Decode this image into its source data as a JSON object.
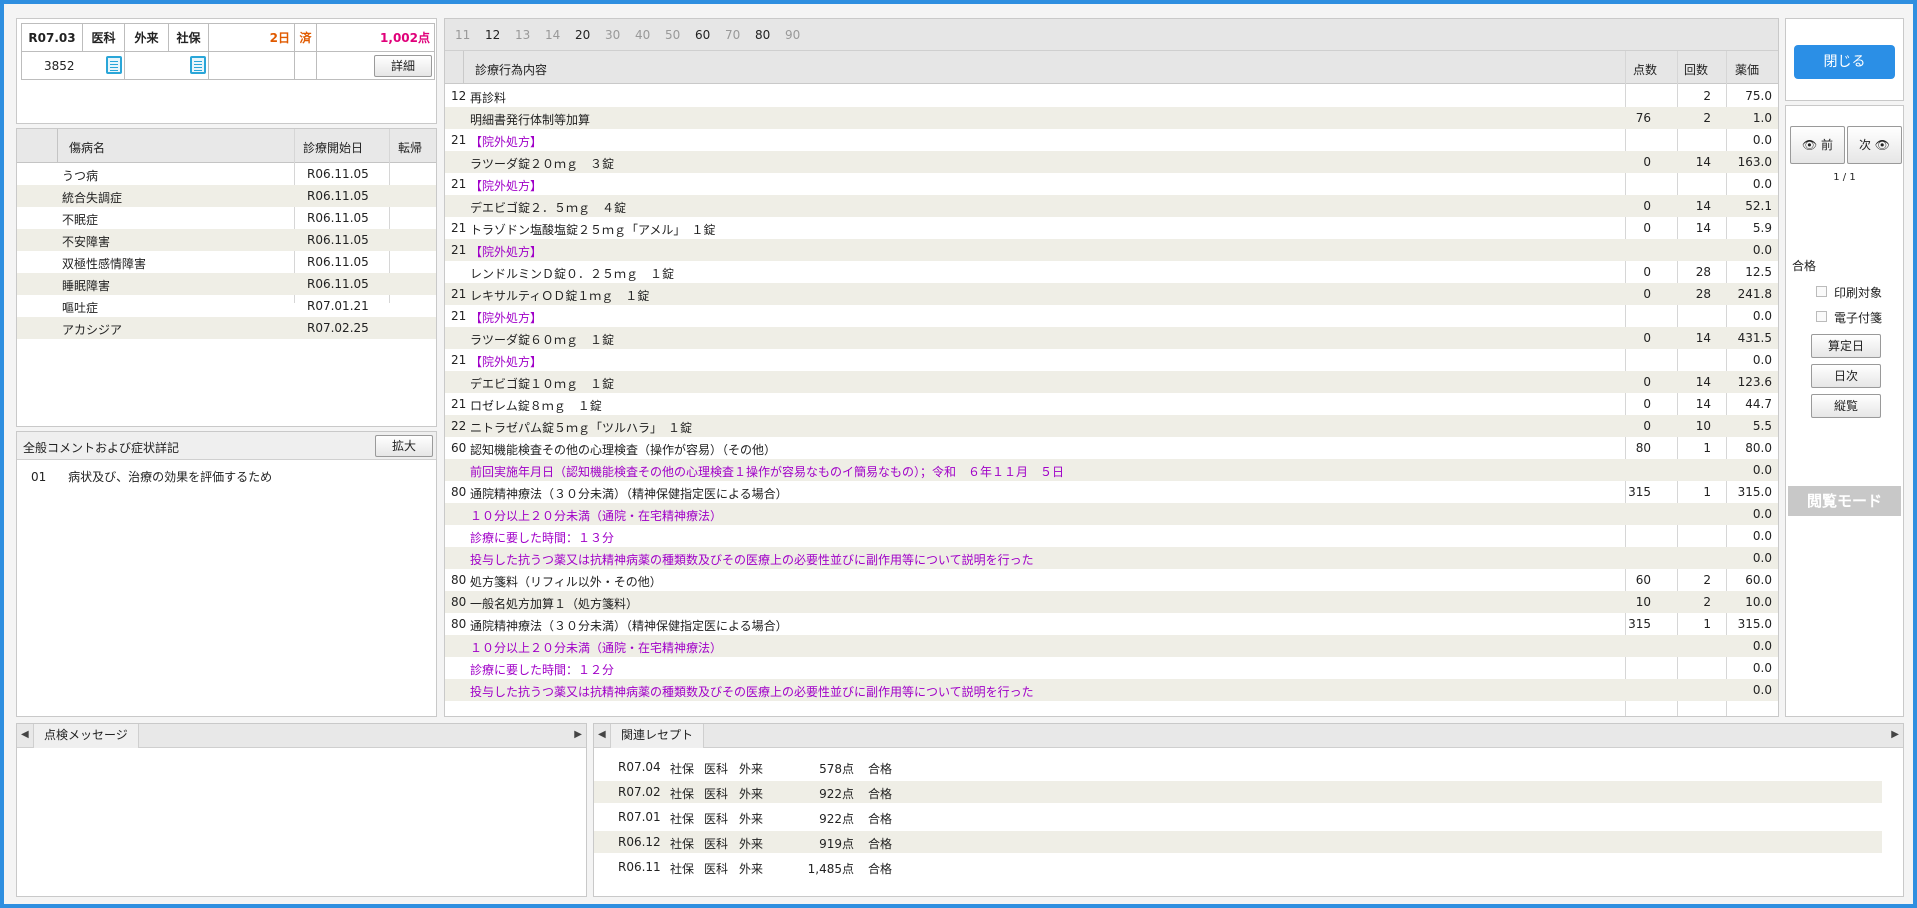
{
  "header": {
    "date": "R07.03",
    "dept": "医科",
    "type": "外来",
    "insurer": "社保",
    "days": "2日",
    "status": "済",
    "points": "1,002点",
    "patient_no": "3852",
    "detail_label": "詳細"
  },
  "diseases": {
    "col_name": "傷病名",
    "col_start": "診療開始日",
    "col_outcome": "転帰",
    "rows": [
      {
        "name": "うつ病",
        "date": "R06.11.05"
      },
      {
        "name": "統合失調症",
        "date": "R06.11.05"
      },
      {
        "name": "不眠症",
        "date": "R06.11.05"
      },
      {
        "name": "不安障害",
        "date": "R06.11.05"
      },
      {
        "name": "双極性感情障害",
        "date": "R06.11.05"
      },
      {
        "name": "睡眠障害",
        "date": "R06.11.05"
      },
      {
        "name": "嘔吐症",
        "date": "R07.01.21"
      },
      {
        "name": "アカシジア",
        "date": "R07.02.25"
      }
    ]
  },
  "comments": {
    "title": "全般コメントおよび症状詳記",
    "expand_label": "拡大",
    "items": [
      {
        "code": "01",
        "text": "病状及び、治療の効果を評価するため"
      }
    ]
  },
  "main": {
    "tabs": [
      "11",
      "12",
      "13",
      "14",
      "20",
      "30",
      "40",
      "50",
      "60",
      "70",
      "80",
      "90"
    ],
    "col_content": "診療行為内容",
    "col_points": "点数",
    "col_count": "回数",
    "col_price": "薬価",
    "rows": [
      {
        "code": "12",
        "text": "再診料",
        "pts": "",
        "cnt": "2",
        "price": "75.0",
        "purple": false
      },
      {
        "code": "",
        "text": "明細書発行体制等加算",
        "pts": "76",
        "cnt": "2",
        "price": "1.0",
        "purple": false
      },
      {
        "code": "21",
        "text": "【院外処方】",
        "pts": "",
        "cnt": "",
        "price": "0.0",
        "purple": true
      },
      {
        "code": "",
        "text": "ラツーダ錠２０ｍｇ　３錠",
        "pts": "0",
        "cnt": "14",
        "price": "163.0",
        "purple": false
      },
      {
        "code": "21",
        "text": "【院外処方】",
        "pts": "",
        "cnt": "",
        "price": "0.0",
        "purple": true
      },
      {
        "code": "",
        "text": "デエビゴ錠２．５ｍｇ　４錠",
        "pts": "0",
        "cnt": "14",
        "price": "52.1",
        "purple": false
      },
      {
        "code": "21",
        "text": "トラゾドン塩酸塩錠２５ｍｇ「アメル」　１錠",
        "pts": "0",
        "cnt": "14",
        "price": "5.9",
        "purple": false
      },
      {
        "code": "21",
        "text": "【院外処方】",
        "pts": "",
        "cnt": "",
        "price": "0.0",
        "purple": true
      },
      {
        "code": "",
        "text": "レンドルミンＤ錠０．２５ｍｇ　１錠",
        "pts": "0",
        "cnt": "28",
        "price": "12.5",
        "purple": false
      },
      {
        "code": "21",
        "text": "レキサルティＯＤ錠１ｍｇ　１錠",
        "pts": "0",
        "cnt": "28",
        "price": "241.8",
        "purple": false
      },
      {
        "code": "21",
        "text": "【院外処方】",
        "pts": "",
        "cnt": "",
        "price": "0.0",
        "purple": true
      },
      {
        "code": "",
        "text": "ラツーダ錠６０ｍｇ　１錠",
        "pts": "0",
        "cnt": "14",
        "price": "431.5",
        "purple": false
      },
      {
        "code": "21",
        "text": "【院外処方】",
        "pts": "",
        "cnt": "",
        "price": "0.0",
        "purple": true
      },
      {
        "code": "",
        "text": "デエビゴ錠１０ｍｇ　１錠",
        "pts": "0",
        "cnt": "14",
        "price": "123.6",
        "purple": false
      },
      {
        "code": "21",
        "text": "ロゼレム錠８ｍｇ　１錠",
        "pts": "0",
        "cnt": "14",
        "price": "44.7",
        "purple": false
      },
      {
        "code": "22",
        "text": "ニトラゼパム錠５ｍｇ「ツルハラ」　１錠",
        "pts": "0",
        "cnt": "10",
        "price": "5.5",
        "purple": false
      },
      {
        "code": "60",
        "text": "認知機能検査その他の心理検査（操作が容易）（その他）",
        "pts": "80",
        "cnt": "1",
        "price": "80.0",
        "purple": false
      },
      {
        "code": "",
        "text": "前回実施年月日（認知機能検査その他の心理検査１操作が容易なものイ簡易なもの）；令和　６年１１月　５日",
        "pts": "",
        "cnt": "",
        "price": "0.0",
        "purple": true
      },
      {
        "code": "80",
        "text": "通院精神療法（３０分未満）（精神保健指定医による場合）",
        "pts": "315",
        "cnt": "1",
        "price": "315.0",
        "purple": false
      },
      {
        "code": "",
        "text": "１０分以上２０分未満（通院・在宅精神療法）",
        "pts": "",
        "cnt": "",
        "price": "0.0",
        "purple": true
      },
      {
        "code": "",
        "text": "診療に要した時間：１３分",
        "pts": "",
        "cnt": "",
        "price": "0.0",
        "purple": true
      },
      {
        "code": "",
        "text": "投与した抗うつ薬又は抗精神病薬の種類数及びその医療上の必要性並びに副作用等について説明を行った",
        "pts": "",
        "cnt": "",
        "price": "0.0",
        "purple": true
      },
      {
        "code": "80",
        "text": "処方箋料（リフィル以外・その他）",
        "pts": "60",
        "cnt": "2",
        "price": "60.0",
        "purple": false
      },
      {
        "code": "80",
        "text": "一般名処方加算１（処方箋料）",
        "pts": "10",
        "cnt": "2",
        "price": "10.0",
        "purple": false
      },
      {
        "code": "80",
        "text": "通院精神療法（３０分未満）（精神保健指定医による場合）",
        "pts": "315",
        "cnt": "1",
        "price": "315.0",
        "purple": false
      },
      {
        "code": "",
        "text": "１０分以上２０分未満（通院・在宅精神療法）",
        "pts": "",
        "cnt": "",
        "price": "0.0",
        "purple": true
      },
      {
        "code": "",
        "text": "診療に要した時間：１２分",
        "pts": "",
        "cnt": "",
        "price": "0.0",
        "purple": true
      },
      {
        "code": "",
        "text": "投与した抗うつ薬又は抗精神病薬の種類数及びその医療上の必要性並びに副作用等について説明を行った",
        "pts": "",
        "cnt": "",
        "price": "0.0",
        "purple": true
      }
    ]
  },
  "side": {
    "close_label": "閉じる",
    "prev_label": "前",
    "next_label": "次",
    "page_indicator": "1 / 1",
    "result": "合格",
    "print_target": "印刷対象",
    "e_attach": "電子付箋",
    "calc_date": "算定日",
    "daily": "日次",
    "overview": "縦覧",
    "view_mode": "閲覧モード"
  },
  "bottom": {
    "check_tab": "点検メッセージ",
    "related_tab": "関連レセプト",
    "related": [
      {
        "ym": "R07.04",
        "ins": "社保",
        "dept": "医科",
        "type": "外来",
        "pts": "578点",
        "res": "合格"
      },
      {
        "ym": "R07.02",
        "ins": "社保",
        "dept": "医科",
        "type": "外来",
        "pts": "922点",
        "res": "合格"
      },
      {
        "ym": "R07.01",
        "ins": "社保",
        "dept": "医科",
        "type": "外来",
        "pts": "922点",
        "res": "合格"
      },
      {
        "ym": "R06.12",
        "ins": "社保",
        "dept": "医科",
        "type": "外来",
        "pts": "919点",
        "res": "合格"
      },
      {
        "ym": "R06.11",
        "ins": "社保",
        "dept": "医科",
        "type": "外来",
        "pts": "1,485点",
        "res": "合格"
      }
    ]
  },
  "colors": {
    "accent": "#2f8fe0",
    "close_button": "#2b8fe6",
    "purple_text": "#a000c8",
    "days": "#e05a00",
    "points": "#e0007a"
  }
}
